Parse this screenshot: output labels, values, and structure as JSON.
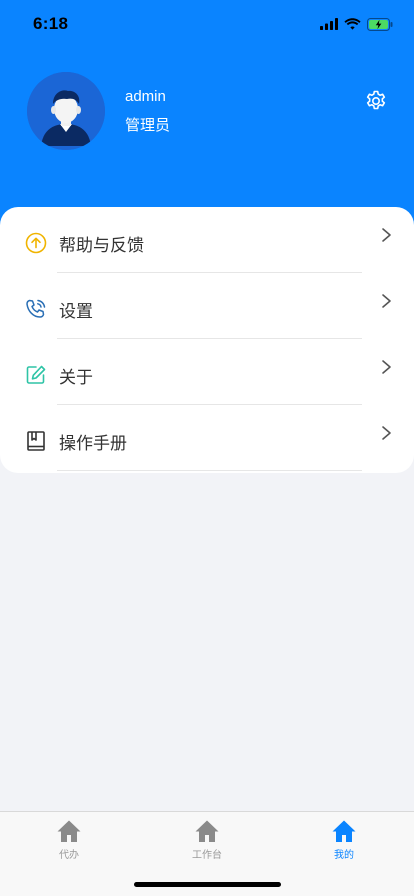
{
  "status_bar": {
    "time": "6:18",
    "icons": [
      "signal-icon",
      "wifi-icon",
      "battery-charging-icon"
    ]
  },
  "profile": {
    "username": "admin",
    "role": "管理员",
    "avatar_icon": "user-avatar-icon",
    "settings_icon": "gear-icon"
  },
  "menu": {
    "items": [
      {
        "label": "帮助与反馈",
        "icon": "arrow-up-circle-icon",
        "icon_color": "#f0b400"
      },
      {
        "label": "设置",
        "icon": "phone-icon",
        "icon_color": "#2a6fb5"
      },
      {
        "label": "关于",
        "icon": "edit-icon",
        "icon_color": "#2ec4a6"
      },
      {
        "label": "操作手册",
        "icon": "book-icon",
        "icon_color": "#333333"
      }
    ]
  },
  "tab_bar": {
    "tabs": [
      {
        "label": "代办",
        "icon": "home-icon",
        "active": false
      },
      {
        "label": "工作台",
        "icon": "home-icon",
        "active": false
      },
      {
        "label": "我的",
        "icon": "home-icon",
        "active": true
      }
    ]
  },
  "colors": {
    "primary": "#0a84ff",
    "background": "#f2f3f7",
    "tab_inactive": "#999999",
    "tab_active": "#0a84ff"
  }
}
